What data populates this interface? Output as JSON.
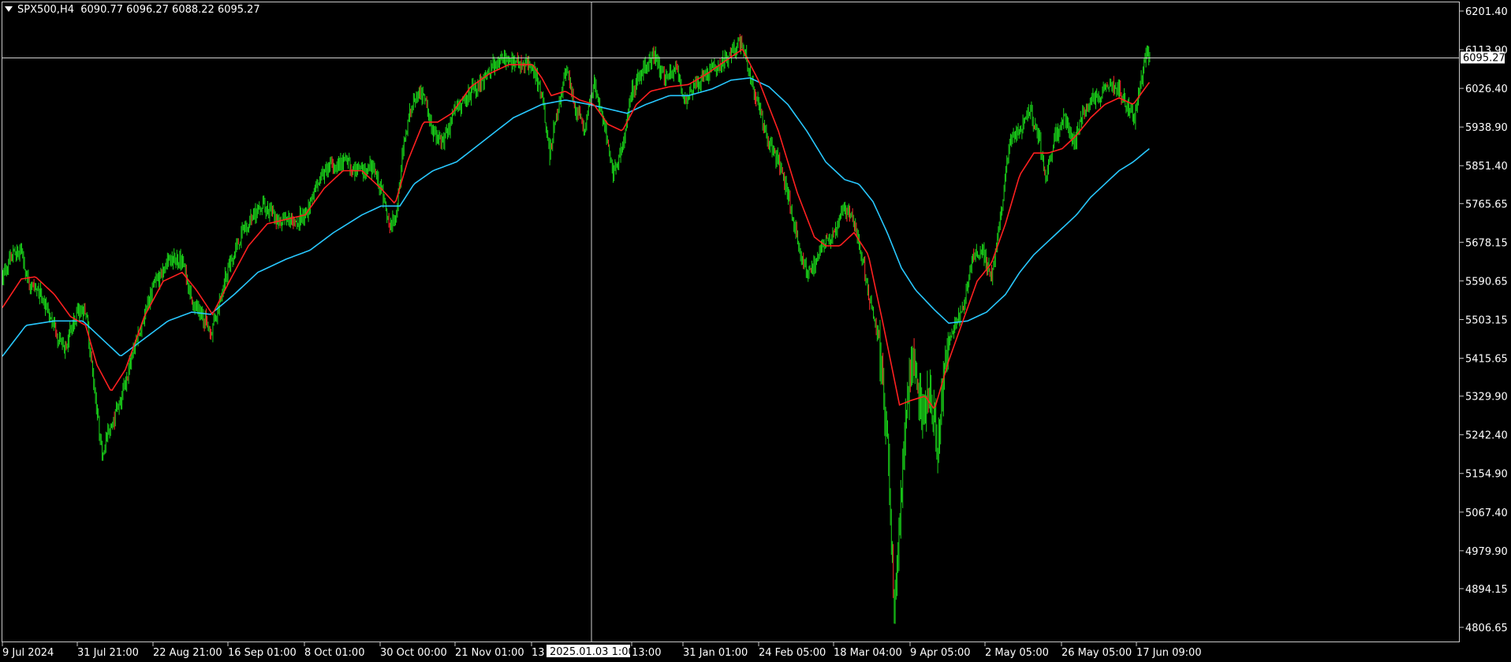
{
  "header": {
    "symbol": "SPX500,H4",
    "ohlc": "6090.77 6096.27 6088.22 6095.27"
  },
  "colors": {
    "background": "#000000",
    "frame": "#c8c8c8",
    "text": "#ffffff",
    "candle": "#19d219",
    "candle_down": "#ff2a2a",
    "ma_fast": "#ff2020",
    "ma_slow": "#28c8ff",
    "crosshair": "#d0d0d0",
    "price_tag_bg": "#ffffff",
    "price_tag_text": "#000000"
  },
  "chart_data": {
    "type": "line",
    "instrument": "SPX500",
    "timeframe": "H4",
    "ylim": [
      4763.4,
      6244.6
    ],
    "grid": false,
    "y_ticks": [
      "6201.40",
      "6113.90",
      "6026.40",
      "5938.90",
      "5851.40",
      "5765.65",
      "5678.15",
      "5590.65",
      "5503.15",
      "5415.65",
      "5329.90",
      "5242.40",
      "5154.90",
      "5067.40",
      "4979.90",
      "4894.15",
      "4806.65"
    ],
    "x_ticks": [
      "9 Jul 2024",
      "31 Jul 21:00",
      "22 Aug 21:00",
      "16 Sep 01:00",
      "8 Oct 01:00",
      "30 Oct 00:00",
      "21 Nov 01:00",
      "13 Dec",
      "13:00",
      "31 Jan 01:00",
      "24 Feb 05:00",
      "18 Mar 04:00",
      "9 Apr 05:00",
      "2 May 05:00",
      "26 May 05:00",
      "17 Jun 09:00"
    ],
    "current_price": "6095.27",
    "crosshair_time": "2025.01.03 1:00",
    "price_anchors": [
      [
        0,
        5600
      ],
      [
        10,
        5650
      ],
      [
        20,
        5655
      ],
      [
        28,
        5580
      ],
      [
        40,
        5560
      ],
      [
        55,
        5480
      ],
      [
        65,
        5440
      ],
      [
        80,
        5520
      ],
      [
        88,
        5520
      ],
      [
        95,
        5380
      ],
      [
        105,
        5200
      ],
      [
        112,
        5250
      ],
      [
        125,
        5320
      ],
      [
        140,
        5450
      ],
      [
        160,
        5580
      ],
      [
        175,
        5640
      ],
      [
        190,
        5640
      ],
      [
        200,
        5540
      ],
      [
        210,
        5520
      ],
      [
        220,
        5470
      ],
      [
        235,
        5600
      ],
      [
        255,
        5710
      ],
      [
        275,
        5765
      ],
      [
        290,
        5730
      ],
      [
        305,
        5720
      ],
      [
        320,
        5740
      ],
      [
        330,
        5800
      ],
      [
        345,
        5850
      ],
      [
        360,
        5860
      ],
      [
        375,
        5840
      ],
      [
        390,
        5845
      ],
      [
        400,
        5800
      ],
      [
        408,
        5720
      ],
      [
        415,
        5730
      ],
      [
        425,
        5920
      ],
      [
        435,
        6010
      ],
      [
        445,
        6010
      ],
      [
        455,
        5930
      ],
      [
        465,
        5905
      ],
      [
        480,
        5980
      ],
      [
        495,
        6020
      ],
      [
        510,
        6050
      ],
      [
        520,
        6085
      ],
      [
        530,
        6090
      ],
      [
        545,
        6080
      ],
      [
        560,
        6075
      ],
      [
        570,
        6010
      ],
      [
        578,
        5880
      ],
      [
        585,
        5960
      ],
      [
        595,
        6070
      ],
      [
        605,
        5980
      ],
      [
        615,
        5940
      ],
      [
        625,
        6040
      ],
      [
        635,
        5950
      ],
      [
        645,
        5830
      ],
      [
        655,
        5900
      ],
      [
        665,
        6020
      ],
      [
        675,
        6060
      ],
      [
        688,
        6100
      ],
      [
        700,
        6050
      ],
      [
        712,
        6070
      ],
      [
        720,
        6000
      ],
      [
        730,
        6030
      ],
      [
        745,
        6060
      ],
      [
        760,
        6080
      ],
      [
        770,
        6110
      ],
      [
        782,
        6130
      ],
      [
        790,
        6050
      ],
      [
        800,
        5980
      ],
      [
        810,
        5900
      ],
      [
        820,
        5860
      ],
      [
        830,
        5780
      ],
      [
        840,
        5680
      ],
      [
        850,
        5600
      ],
      [
        860,
        5640
      ],
      [
        870,
        5680
      ],
      [
        880,
        5700
      ],
      [
        890,
        5760
      ],
      [
        898,
        5730
      ],
      [
        905,
        5680
      ],
      [
        915,
        5560
      ],
      [
        925,
        5470
      ],
      [
        935,
        5200
      ],
      [
        942,
        4870
      ],
      [
        948,
        5050
      ],
      [
        955,
        5330
      ],
      [
        962,
        5400
      ],
      [
        970,
        5300
      ],
      [
        980,
        5330
      ],
      [
        988,
        5220
      ],
      [
        995,
        5380
      ],
      [
        1005,
        5500
      ],
      [
        1015,
        5520
      ],
      [
        1025,
        5650
      ],
      [
        1035,
        5660
      ],
      [
        1045,
        5600
      ],
      [
        1055,
        5750
      ],
      [
        1065,
        5920
      ],
      [
        1075,
        5930
      ],
      [
        1085,
        5980
      ],
      [
        1095,
        5910
      ],
      [
        1102,
        5830
      ],
      [
        1112,
        5920
      ],
      [
        1122,
        5960
      ],
      [
        1132,
        5900
      ],
      [
        1140,
        5960
      ],
      [
        1150,
        6000
      ],
      [
        1160,
        6010
      ],
      [
        1170,
        6040
      ],
      [
        1180,
        6020
      ],
      [
        1190,
        5980
      ],
      [
        1196,
        5960
      ],
      [
        1202,
        6030
      ],
      [
        1208,
        6110
      ],
      [
        1212,
        6095
      ]
    ],
    "ma_fast_anchors": [
      [
        0,
        5530
      ],
      [
        20,
        5595
      ],
      [
        35,
        5600
      ],
      [
        55,
        5560
      ],
      [
        72,
        5510
      ],
      [
        88,
        5490
      ],
      [
        100,
        5400
      ],
      [
        115,
        5340
      ],
      [
        130,
        5390
      ],
      [
        150,
        5510
      ],
      [
        170,
        5590
      ],
      [
        190,
        5610
      ],
      [
        205,
        5570
      ],
      [
        222,
        5515
      ],
      [
        240,
        5590
      ],
      [
        260,
        5670
      ],
      [
        280,
        5720
      ],
      [
        300,
        5730
      ],
      [
        320,
        5740
      ],
      [
        340,
        5800
      ],
      [
        360,
        5840
      ],
      [
        380,
        5840
      ],
      [
        400,
        5800
      ],
      [
        415,
        5765
      ],
      [
        428,
        5860
      ],
      [
        445,
        5950
      ],
      [
        460,
        5950
      ],
      [
        475,
        5970
      ],
      [
        495,
        6030
      ],
      [
        515,
        6060
      ],
      [
        535,
        6080
      ],
      [
        560,
        6080
      ],
      [
        570,
        6050
      ],
      [
        580,
        6010
      ],
      [
        595,
        6020
      ],
      [
        610,
        6000
      ],
      [
        625,
        5990
      ],
      [
        640,
        5945
      ],
      [
        655,
        5930
      ],
      [
        670,
        5990
      ],
      [
        685,
        6020
      ],
      [
        705,
        6030
      ],
      [
        725,
        6035
      ],
      [
        745,
        6060
      ],
      [
        765,
        6090
      ],
      [
        782,
        6115
      ],
      [
        800,
        6040
      ],
      [
        820,
        5930
      ],
      [
        840,
        5790
      ],
      [
        858,
        5690
      ],
      [
        870,
        5670
      ],
      [
        885,
        5670
      ],
      [
        900,
        5700
      ],
      [
        915,
        5650
      ],
      [
        930,
        5500
      ],
      [
        948,
        5310
      ],
      [
        960,
        5320
      ],
      [
        975,
        5330
      ],
      [
        985,
        5300
      ],
      [
        1000,
        5410
      ],
      [
        1015,
        5500
      ],
      [
        1030,
        5590
      ],
      [
        1045,
        5630
      ],
      [
        1060,
        5720
      ],
      [
        1075,
        5830
      ],
      [
        1090,
        5880
      ],
      [
        1105,
        5880
      ],
      [
        1120,
        5890
      ],
      [
        1135,
        5920
      ],
      [
        1150,
        5960
      ],
      [
        1165,
        5990
      ],
      [
        1180,
        6005
      ],
      [
        1195,
        5990
      ],
      [
        1212,
        6040
      ]
    ],
    "ma_slow_anchors": [
      [
        0,
        5420
      ],
      [
        25,
        5490
      ],
      [
        55,
        5500
      ],
      [
        85,
        5500
      ],
      [
        105,
        5460
      ],
      [
        125,
        5420
      ],
      [
        150,
        5460
      ],
      [
        175,
        5500
      ],
      [
        200,
        5520
      ],
      [
        220,
        5515
      ],
      [
        245,
        5560
      ],
      [
        270,
        5610
      ],
      [
        300,
        5640
      ],
      [
        325,
        5660
      ],
      [
        350,
        5700
      ],
      [
        380,
        5740
      ],
      [
        400,
        5760
      ],
      [
        420,
        5760
      ],
      [
        435,
        5810
      ],
      [
        455,
        5840
      ],
      [
        480,
        5860
      ],
      [
        510,
        5910
      ],
      [
        540,
        5960
      ],
      [
        570,
        5990
      ],
      [
        595,
        6000
      ],
      [
        620,
        5990
      ],
      [
        640,
        5980
      ],
      [
        660,
        5970
      ],
      [
        680,
        5990
      ],
      [
        705,
        6010
      ],
      [
        725,
        6010
      ],
      [
        750,
        6025
      ],
      [
        770,
        6045
      ],
      [
        790,
        6050
      ],
      [
        810,
        6030
      ],
      [
        830,
        5990
      ],
      [
        850,
        5930
      ],
      [
        870,
        5860
      ],
      [
        890,
        5820
      ],
      [
        905,
        5810
      ],
      [
        920,
        5770
      ],
      [
        935,
        5700
      ],
      [
        950,
        5620
      ],
      [
        965,
        5570
      ],
      [
        985,
        5525
      ],
      [
        1000,
        5495
      ],
      [
        1020,
        5500
      ],
      [
        1040,
        5520
      ],
      [
        1060,
        5560
      ],
      [
        1075,
        5610
      ],
      [
        1090,
        5650
      ],
      [
        1105,
        5680
      ],
      [
        1120,
        5710
      ],
      [
        1135,
        5740
      ],
      [
        1150,
        5780
      ],
      [
        1165,
        5810
      ],
      [
        1180,
        5840
      ],
      [
        1195,
        5860
      ],
      [
        1212,
        5890
      ]
    ]
  }
}
